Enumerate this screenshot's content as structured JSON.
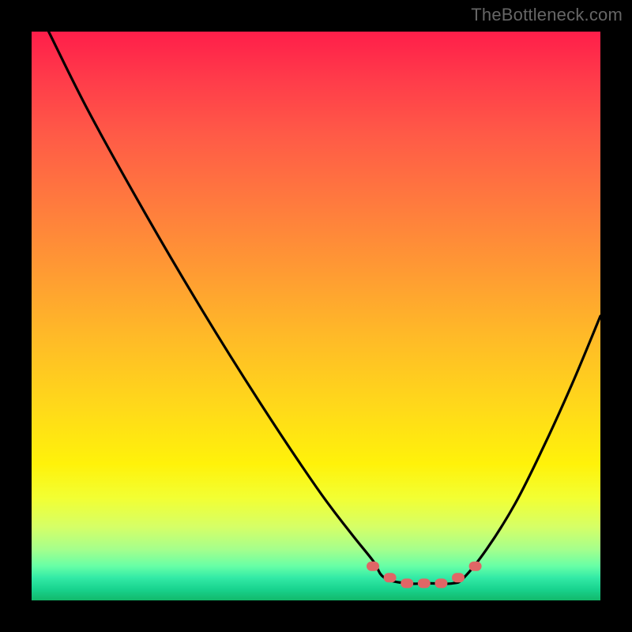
{
  "watermark": "TheBottleneck.com",
  "colors": {
    "frame": "#000000",
    "curve": "#000000",
    "marker": "#e06666",
    "gradient_stops": [
      "#ff1e4a",
      "#ff7a3e",
      "#ffd91a",
      "#f2ff33",
      "#66ffa6",
      "#12b86a"
    ]
  },
  "chart_data": {
    "type": "line",
    "title": "",
    "xlabel": "",
    "ylabel": "",
    "xlim": [
      0,
      100
    ],
    "ylim": [
      0,
      100
    ],
    "note": "x is horizontal position (% of plot width), y is bottleneck percentage (0 = top / worst, 100 = bottom / best). Curve forms a V with a flat minimum around x≈62–75 at y≈97.",
    "series": [
      {
        "name": "bottleneck-curve",
        "x": [
          3,
          10,
          20,
          30,
          40,
          50,
          56,
          60,
          62,
          66,
          70,
          74,
          76,
          80,
          85,
          90,
          95,
          100
        ],
        "y": [
          0,
          14,
          32,
          49,
          65,
          80,
          88,
          93,
          96,
          97,
          97,
          97,
          96,
          91,
          83,
          73,
          62,
          50
        ]
      }
    ],
    "markers": {
      "name": "optimal-range",
      "x": [
        60,
        63,
        66,
        69,
        72,
        75,
        78
      ],
      "y": [
        94,
        96,
        97,
        97,
        97,
        96,
        94
      ]
    }
  }
}
